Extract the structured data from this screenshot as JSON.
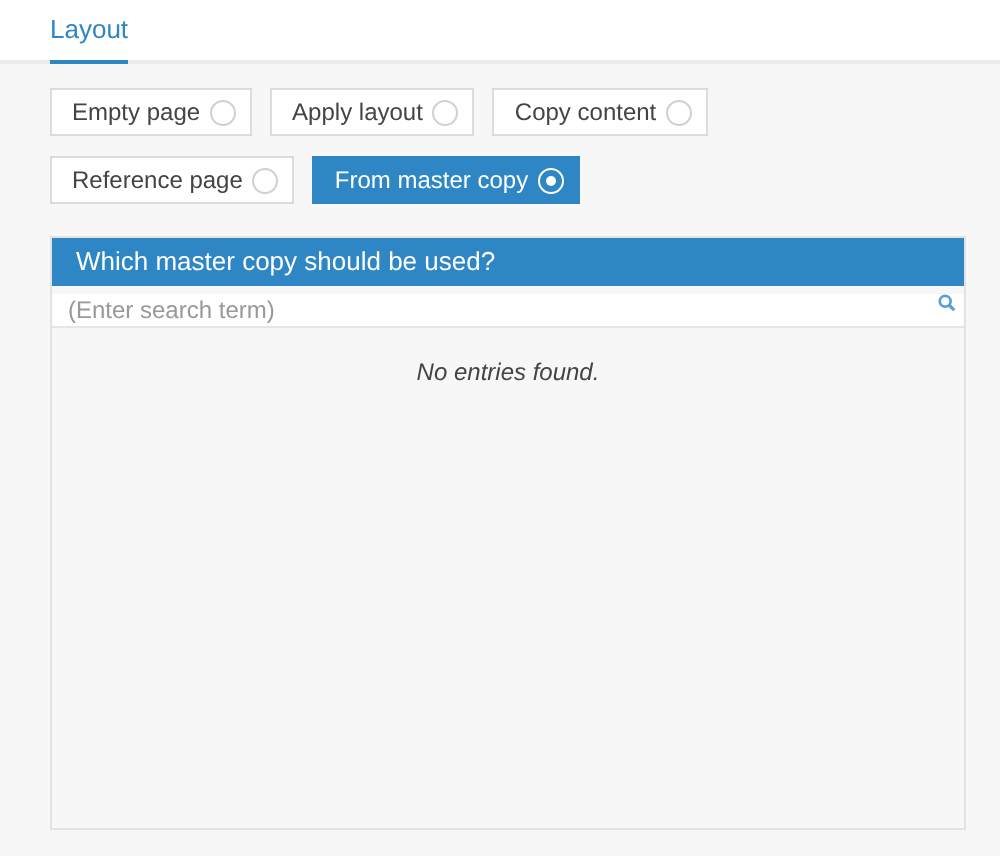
{
  "tabs": [
    {
      "label": "Layout",
      "selected": true
    }
  ],
  "options": [
    {
      "label": "Empty page",
      "selected": false
    },
    {
      "label": "Apply layout",
      "selected": false
    },
    {
      "label": "Copy content",
      "selected": false
    },
    {
      "label": "Reference page",
      "selected": false
    },
    {
      "label": "From master copy",
      "selected": true
    }
  ],
  "master_copy_panel": {
    "title": "Which master copy should be used?",
    "search": {
      "placeholder": "(Enter search term)"
    },
    "empty_message": "No entries found."
  }
}
